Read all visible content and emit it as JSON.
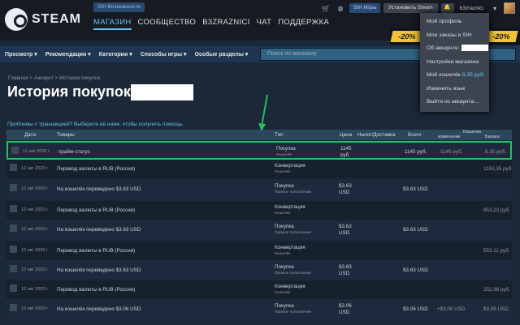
{
  "header": {
    "logo_text": "STEAM",
    "sih_label": "SIH Возможности",
    "nav": [
      "МАГАЗИН",
      "СООБЩЕСТВО",
      "B3ZRAZNICI",
      "ЧАТ",
      "ПОДДЕРЖКА"
    ],
    "sih_games_label": "SIH Игры",
    "install_label": "Установить Steam",
    "username": "b3zraznici"
  },
  "account_menu": {
    "items": [
      "Мой профиль",
      "Мои заказы в SIH",
      "Об аккаунте:",
      "Настройки магазина",
      "Мой кошелёк",
      "Изменить язык",
      "Выйти из аккаунта..."
    ],
    "wallet_value": "8,35 руб."
  },
  "promo": {
    "badge_left": "-20%",
    "badge_right": "-20%"
  },
  "store_nav": {
    "items": [
      "Просмотр ▾",
      "Рекомендации ▾",
      "Категории ▾",
      "Способы игры ▾",
      "Особые разделы ▾"
    ],
    "search_placeholder": "Поиск по магазину"
  },
  "breadcrumb": "Главная > Аккаунт > История покупок",
  "page_title": "История покупок",
  "help_link": "Проблемы с транзакцией? Выберите её ниже, чтобы получить помощь.",
  "table": {
    "headers": {
      "date": "Дата",
      "items": "Товары",
      "type": "Тип",
      "price": "Цена",
      "tax": "Налог/Доставка",
      "total": "Всего",
      "wallet_change_top": "Кошелёк",
      "wallet_change": "изменение",
      "wallet_balance": "Баланс"
    },
    "rows": [
      {
        "date": "12 авг 2020 г.",
        "item": "прайм-статус",
        "type": "Покупка",
        "sub": "Кошелёк",
        "price": "1145\nруб.",
        "total": "1145 руб.",
        "wchg": "-1145 руб.",
        "wbal": "8,35 руб."
      },
      {
        "date": "12 авг 2020 г.",
        "item": "Перевод валюты в RUB (Россия)",
        "type": "Конвертация",
        "sub": "Кошелёк",
        "price": "",
        "total": "",
        "wchg": "",
        "wbal": "1153,35 руб."
      },
      {
        "date": "12 авг 2020 г.",
        "item": "На кошелёк переведено $3.63 USD",
        "type": "Покупка",
        "sub": "Прямое пополнение",
        "price": "$3.63\nUSD",
        "total": "$3.63 USD",
        "wchg": "",
        "wbal": ""
      },
      {
        "date": "12 авг 2020 г.",
        "item": "Перевод валюты в RUB (Россия)",
        "type": "Конвертация",
        "sub": "Кошелёк",
        "price": "",
        "total": "",
        "wchg": "",
        "wbal": "853,23 руб."
      },
      {
        "date": "12 авг 2020 г.",
        "item": "На кошелёк переведено $3.63 USD",
        "type": "Покупка",
        "sub": "Прямое пополнение",
        "price": "$3.63\nUSD",
        "total": "$3.63 USD",
        "wchg": "",
        "wbal": ""
      },
      {
        "date": "12 авг 2020 г.",
        "item": "Перевод валюты в RUB (Россия)",
        "type": "Конвертация",
        "sub": "Кошелёк",
        "price": "",
        "total": "",
        "wchg": "",
        "wbal": "553,11 руб."
      },
      {
        "date": "12 авг 2020 г.",
        "item": "На кошелёк переведено $3.63 USD",
        "type": "Покупка",
        "sub": "Прямое пополнение",
        "price": "$3.63\nUSD",
        "total": "$3.63 USD",
        "wchg": "",
        "wbal": ""
      },
      {
        "date": "12 авг 2020 г.",
        "item": "Перевод валюты в RUB (Россия)",
        "type": "Конвертация",
        "sub": "Кошелёк",
        "price": "",
        "total": "",
        "wchg": "",
        "wbal": "252,98 руб."
      },
      {
        "date": "12 авг 2020 г.",
        "item": "На кошелёк переведено $3.06 USD",
        "type": "Покупка",
        "sub": "Прямое пополнение",
        "price": "$3.06\nUSD",
        "total": "$3.06 USD",
        "wchg": "+$3.06 USD",
        "wbal": "$3.06 USD"
      }
    ]
  },
  "colors": {
    "highlight": "#22c061",
    "accent": "#66c0f4",
    "background": "#1b2838"
  }
}
